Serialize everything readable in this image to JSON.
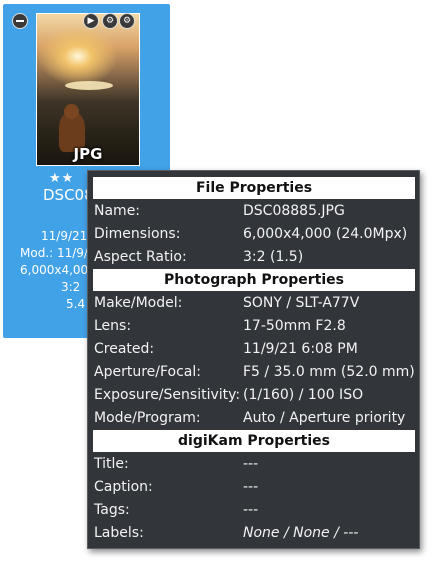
{
  "thumbnail": {
    "format_label": "JPG",
    "rating_stars": "★★",
    "name_truncated": "DSC088",
    "date_truncated": "11/9/21",
    "modified_truncated": "Mod.: 11/9/",
    "size_truncated": "6,000x4,000",
    "ratio_truncated": "3:2",
    "extra_truncated": "5.4",
    "play_icon": "▶"
  },
  "tooltip": {
    "file_section": "File Properties",
    "file_rows": [
      {
        "key": "Name:",
        "value": "DSC08885.JPG"
      },
      {
        "key": "Dimensions:",
        "value": "6,000x4,000 (24.0Mpx)"
      },
      {
        "key": "Aspect Ratio:",
        "value": "3:2 (1.5)"
      }
    ],
    "photo_section": "Photograph Properties",
    "photo_rows": [
      {
        "key": "Make/Model:",
        "value": "SONY / SLT-A77V"
      },
      {
        "key": "Lens:",
        "value": "17-50mm F2.8"
      },
      {
        "key": "Created:",
        "value": "11/9/21 6:08 PM"
      },
      {
        "key": "Aperture/Focal:",
        "value": "F5 / 35.0 mm (52.0 mm)"
      },
      {
        "key": "Exposure/Sensitivity:",
        "value": "(1/160) / 100 ISO"
      },
      {
        "key": "Mode/Program:",
        "value": "Auto / Aperture priority"
      }
    ],
    "digikam_section": "digiKam Properties",
    "digikam_rows": [
      {
        "key": "Title:",
        "value": "---"
      },
      {
        "key": "Caption:",
        "value": "---"
      },
      {
        "key": "Tags:",
        "value": "---"
      },
      {
        "key": "Labels:",
        "value": "None / None / ---"
      }
    ]
  }
}
